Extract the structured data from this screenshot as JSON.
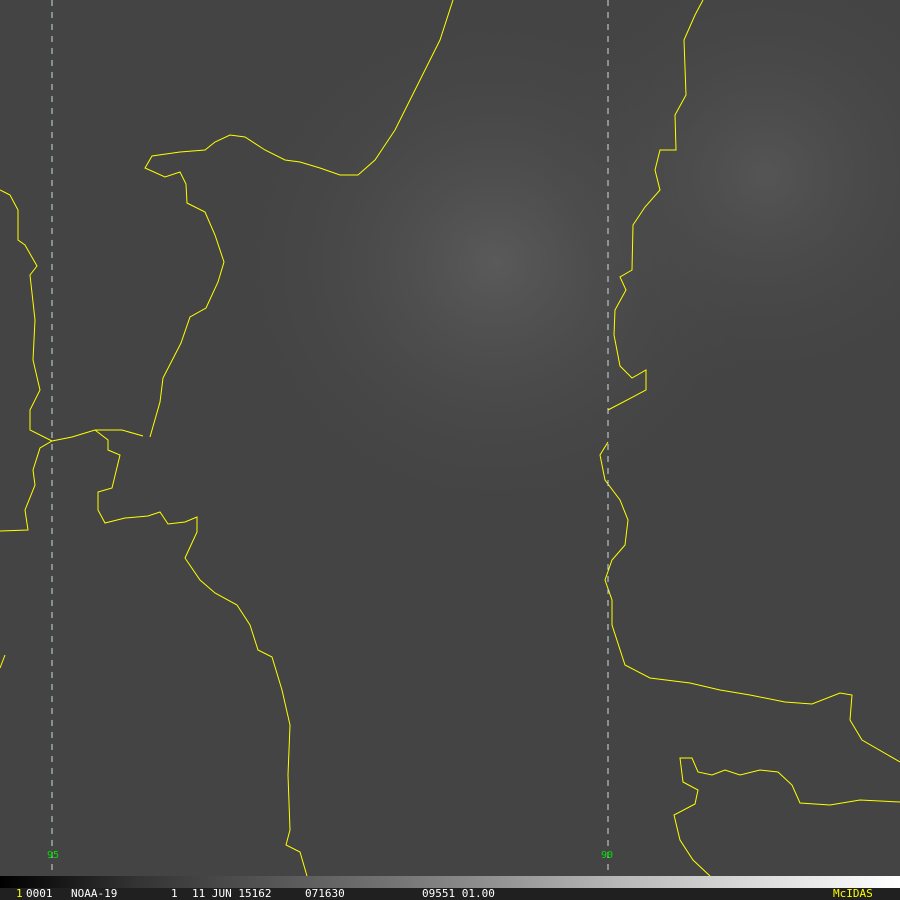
{
  "longitude_labels": [
    "95",
    "90"
  ],
  "status_bar": {
    "frame": "1",
    "image_id": "0001",
    "satellite": "NOAA-19",
    "band": "1",
    "date": "11 JUN 15162",
    "time": "071630",
    "info": "09551 01.00",
    "brand": "McIDAS"
  },
  "colors": {
    "coastline": "#ffff00",
    "gridline": "#c8e0e0",
    "label": "#00e000",
    "brand": "#ffff00"
  }
}
